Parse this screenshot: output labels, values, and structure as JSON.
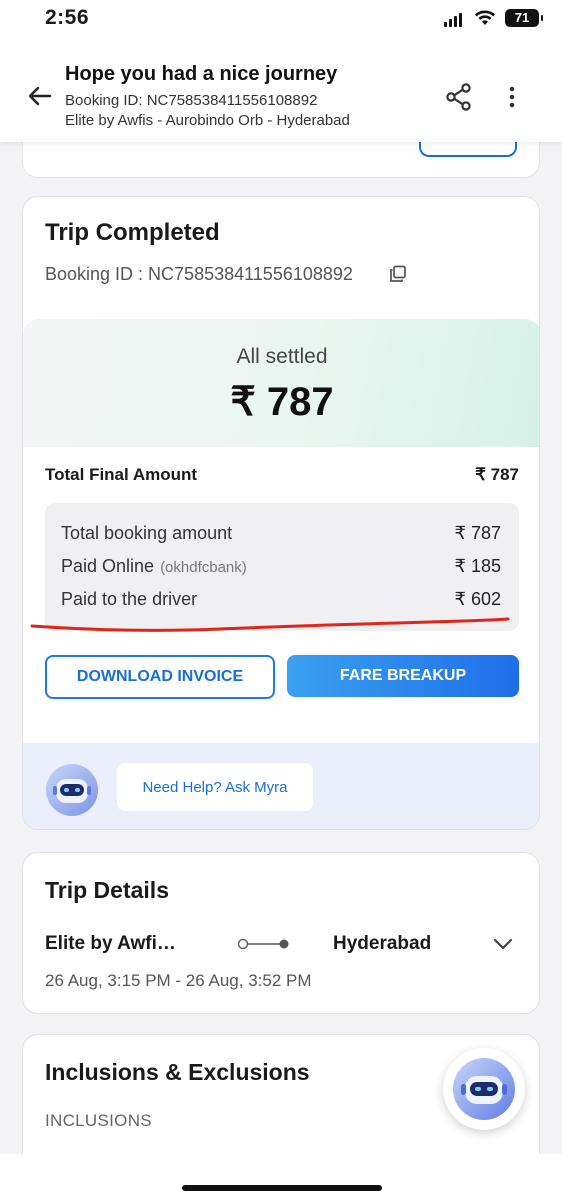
{
  "status_bar": {
    "time": "2:56",
    "battery": "71"
  },
  "header": {
    "title": "Hope you had a nice journey",
    "booking_line": "Booking ID: NC758538411556108892",
    "location_line": "Elite by Awfis - Aurobindo Orb - Hyderabad"
  },
  "trip_card": {
    "title": "Trip Completed",
    "booking_id": "Booking ID : NC758538411556108892",
    "settled_label": "All settled",
    "settled_amount": "₹ 787",
    "total_label": "Total Final Amount",
    "total_value": "₹ 787",
    "breakdown": [
      {
        "label": "Total booking amount",
        "sub": "",
        "value": "₹ 787"
      },
      {
        "label": "Paid Online",
        "sub": "(okhdfcbank)",
        "value": "₹ 185"
      },
      {
        "label": "Paid to the driver",
        "sub": "",
        "value": "₹ 602"
      }
    ],
    "download_invoice": "DOWNLOAD INVOICE",
    "fare_breakup": "FARE BREAKUP",
    "help_label": "Need Help? Ask Myra"
  },
  "trip_details": {
    "title": "Trip Details",
    "from": "Elite by Awfi…",
    "to": "Hyderabad",
    "time_range": "26 Aug, 3:15 PM - 26 Aug, 3:52 PM"
  },
  "inclusions": {
    "title": "Inclusions & Exclusions",
    "subtitle": "INCLUSIONS"
  },
  "colors": {
    "accent": "#1a6fd4",
    "annotation_red": "#e0261b"
  }
}
